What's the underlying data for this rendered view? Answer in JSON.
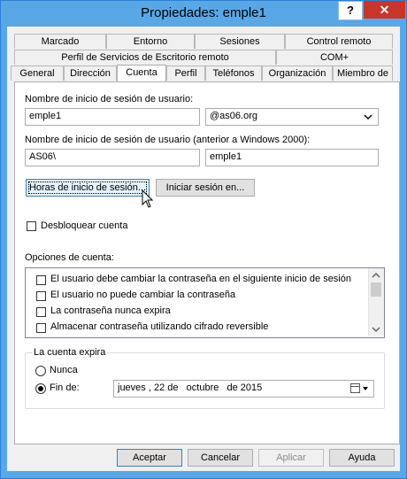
{
  "window": {
    "title": "Propiedades: emple1",
    "help_glyph": "?",
    "close_glyph": "✕"
  },
  "tabs_row1": [
    "Marcado",
    "Entorno",
    "Sesiones",
    "Control remoto"
  ],
  "tabs_row2": [
    "Perfil de Servicios de Escritorio remoto",
    "COM+"
  ],
  "tabs_row3": [
    "General",
    "Dirección",
    "Cuenta",
    "Perfil",
    "Teléfonos",
    "Organización",
    "Miembro de"
  ],
  "active_tab": "Cuenta",
  "account": {
    "logon_label": "Nombre de inicio de sesión de usuario:",
    "logon_name": "emple1",
    "domain_suffix": "@as06.org",
    "pre2000_label": "Nombre de inicio de sesión de usuario (anterior a Windows 2000):",
    "pre2000_domain": "AS06\\",
    "pre2000_name": "emple1",
    "hours_button": "Horas de inicio de sesión...",
    "logon_to_button": "Iniciar sesión en...",
    "unlock_label": "Desbloquear cuenta",
    "options_label": "Opciones de cuenta:",
    "options": [
      "El usuario debe cambiar la contraseña en el siguiente inicio de sesión",
      "El usuario no puede cambiar la contraseña",
      "La contraseña nunca expira",
      "Almacenar contraseña utilizando cifrado reversible"
    ],
    "expires_label": "La cuenta expira",
    "never_label": "Nunca",
    "end_label": "Fin de:",
    "end_date": "jueves , 22 de   octubre   de 2015",
    "selected_expiry": "end"
  },
  "buttons": {
    "ok": "Aceptar",
    "cancel": "Cancelar",
    "apply": "Aplicar",
    "help": "Ayuda"
  }
}
